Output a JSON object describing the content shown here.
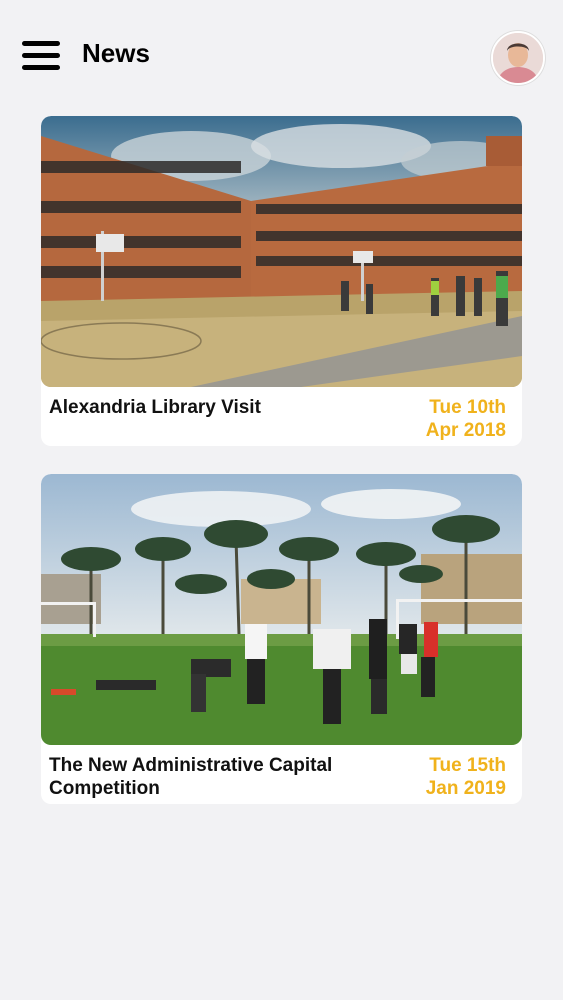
{
  "header": {
    "title": "News",
    "menu_icon": "hamburger-menu-icon",
    "avatar": "user-avatar"
  },
  "news": [
    {
      "title": "Alexandria Library Visit",
      "date_day": "Tue 10th",
      "date_month_year": "Apr 2018"
    },
    {
      "title": "The New Administrative Capital Competition",
      "date_day": "Tue 15th",
      "date_month_year": "Jan 2019"
    }
  ],
  "colors": {
    "background": "#f2f2f4",
    "date_accent": "#f0b21c",
    "text": "#111111"
  }
}
